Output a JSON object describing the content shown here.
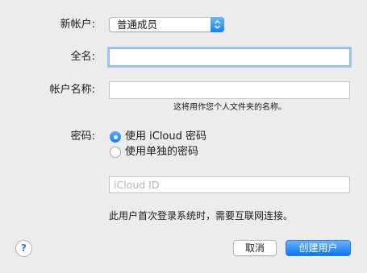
{
  "labels": {
    "new_account": "新帐户:",
    "full_name": "全名:",
    "account_name": "帐户名称:",
    "password": "密码:"
  },
  "account_type": {
    "selected": "普通成员"
  },
  "full_name_field": {
    "value": ""
  },
  "account_name_field": {
    "value": "",
    "help": "这将用作您个人文件夹的名称。"
  },
  "password_options": [
    {
      "label": "使用 iCloud 密码",
      "selected": true
    },
    {
      "label": "使用单独的密码",
      "selected": false
    }
  ],
  "icloud_field": {
    "placeholder": "iCloud ID"
  },
  "notice": "此用户首次登录系统时，需要互联网连接。",
  "buttons": {
    "help": "?",
    "cancel": "取消",
    "create": "创建用户"
  },
  "colors": {
    "accent": "#1a82fb",
    "focus_ring": "#9ec4f2"
  }
}
